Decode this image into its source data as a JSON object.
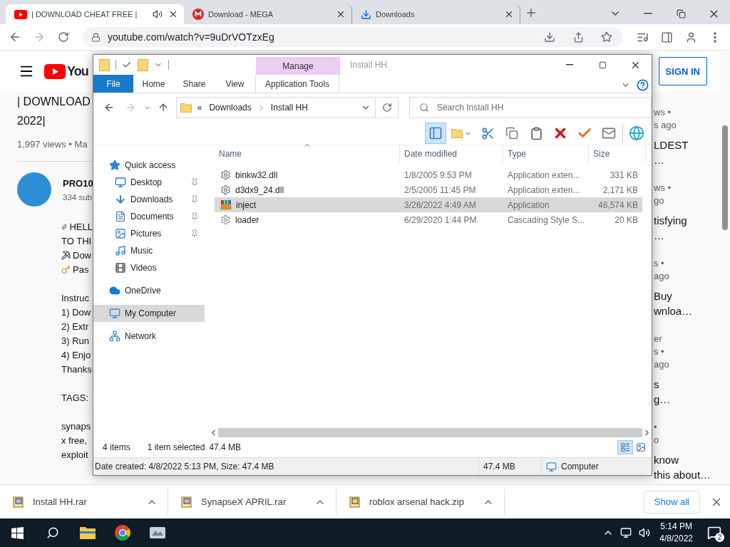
{
  "browser": {
    "tabs": [
      {
        "title": "| DOWNLOAD CHEAT FREE |",
        "kind": "youtube",
        "selected": true,
        "audio": true
      },
      {
        "title": "Download - MEGA",
        "kind": "mega",
        "selected": false,
        "audio": false
      },
      {
        "title": "Downloads",
        "kind": "downloads",
        "selected": false,
        "audio": false
      }
    ],
    "url": "youtube.com/watch?v=9uDrVOTzxEg"
  },
  "youtube": {
    "logo_text": "You",
    "sign_in": "SIGN IN",
    "title_lines": [
      "| DOWNLOAD",
      "2022|"
    ],
    "meta": "1,997 views • Ma",
    "channel": "PRO10",
    "subscribers": "334 sub",
    "description": [
      [
        {
          "text": "HELL",
          "kind": "clip"
        },
        {
          "text": "TO THI",
          "kind": "plain"
        },
        {
          "text": "Dow",
          "kind": "pick"
        },
        {
          "text": "Pas",
          "kind": "key"
        }
      ],
      [
        {
          "text": "Instruc",
          "kind": "plain"
        },
        {
          "text": "1) Dow",
          "kind": "plain"
        },
        {
          "text": "2) Extr",
          "kind": "plain"
        },
        {
          "text": "3) Run",
          "kind": "plain"
        },
        {
          "text": "4) Enjo",
          "kind": "plain"
        },
        {
          "text": "Thanks",
          "kind": "plain"
        }
      ],
      [
        {
          "text": "TAGS:",
          "kind": "plain"
        }
      ],
      [
        {
          "text": "synaps",
          "kind": "plain"
        },
        {
          "text": "x free,",
          "kind": "plain"
        },
        {
          "text": "exploit",
          "kind": "plain"
        }
      ]
    ],
    "sidebar": [
      {
        "meta": [
          "ws •",
          "s ago"
        ],
        "title": [
          "LDEST",
          "…"
        ]
      },
      {
        "meta": [
          "ws •",
          "go"
        ],
        "title": [
          "tisfying",
          "…"
        ]
      },
      {
        "meta": [
          "s •",
          "ago"
        ],
        "title": [
          "Buy",
          "wnloa…"
        ]
      },
      {
        "meta": [
          "er",
          "s •",
          "ago"
        ],
        "title": [
          "s",
          "g…"
        ]
      },
      {
        "meta": [
          "•",
          "o"
        ],
        "title": [
          "know",
          "this about…"
        ]
      }
    ]
  },
  "explorer": {
    "title": "Install HH",
    "context_tab": "Manage",
    "ribbon_tabs": [
      {
        "label": "File",
        "kind": "file",
        "selected": false
      },
      {
        "label": "Home",
        "kind": "tab",
        "selected": false
      },
      {
        "label": "Share",
        "kind": "tab",
        "selected": false
      },
      {
        "label": "View",
        "kind": "tab",
        "selected": false
      },
      {
        "label": "Application Tools",
        "kind": "context",
        "selected": false
      }
    ],
    "breadcrumb_overflow": "«",
    "breadcrumb": [
      "Downloads",
      "Install HH"
    ],
    "search_placeholder": "Search Install HH",
    "toolbar": {
      "preview_pane": {
        "on": true
      }
    },
    "nav": [
      {
        "label": "Quick access",
        "kind": "quick-access",
        "selected": false,
        "children": [
          {
            "label": "Desktop",
            "kind": "desktop",
            "selected": false,
            "pinned": true
          },
          {
            "label": "Downloads",
            "kind": "downloads",
            "selected": false,
            "pinned": true
          },
          {
            "label": "Documents",
            "kind": "documents",
            "selected": false,
            "pinned": true
          },
          {
            "label": "Pictures",
            "kind": "pictures",
            "selected": false,
            "pinned": true
          },
          {
            "label": "Music",
            "kind": "music",
            "selected": false,
            "pinned": false
          },
          {
            "label": "Videos",
            "kind": "videos",
            "selected": false,
            "pinned": false
          }
        ]
      },
      {
        "label": "OneDrive",
        "kind": "onedrive",
        "selected": false
      },
      {
        "label": "My Computer",
        "kind": "computer",
        "selected": true
      },
      {
        "label": "Network",
        "kind": "network",
        "selected": false
      }
    ],
    "columns": [
      "Name",
      "Date modified",
      "Type",
      "Size"
    ],
    "rows": [
      {
        "name": "binkw32.dll",
        "date": "1/8/2005 9:53 PM",
        "type": "Application exten...",
        "size": "331 KB",
        "kind": "dll",
        "selected": false
      },
      {
        "name": "d3dx9_24.dll",
        "date": "2/5/2005 11:45 PM",
        "type": "Application exten...",
        "size": "2,171 KB",
        "kind": "dll",
        "selected": false
      },
      {
        "name": "inject",
        "date": "3/26/2022 4:49 AM",
        "type": "Application",
        "size": "48,574 KB",
        "kind": "app",
        "selected": true
      },
      {
        "name": "loader",
        "date": "6/29/2020 1:44 PM",
        "type": "Cascading Style S...",
        "size": "20 KB",
        "kind": "css",
        "selected": false
      }
    ],
    "status": {
      "count": "4 items",
      "selection": "1 item selected",
      "selection_size": "47.4 MB"
    },
    "views": [
      {
        "kind": "details",
        "selected": true
      },
      {
        "kind": "tiles",
        "selected": false
      }
    ],
    "details_bar": {
      "info": "Date created: 4/8/2022 5:13 PM, Size: 47.4 MB",
      "size": "47.4 MB",
      "location": "Computer"
    }
  },
  "downloads_bar": {
    "items": [
      {
        "name": "Install HH.rar",
        "kind": "rar"
      },
      {
        "name": "SynapseX APRIL.rar",
        "kind": "rar"
      },
      {
        "name": "roblox arsenal hack.zip",
        "kind": "zip"
      }
    ],
    "show_all": "Show all"
  },
  "taskbar": {
    "time": "5:14 PM",
    "date": "4/8/2022",
    "notifications": "2"
  }
}
